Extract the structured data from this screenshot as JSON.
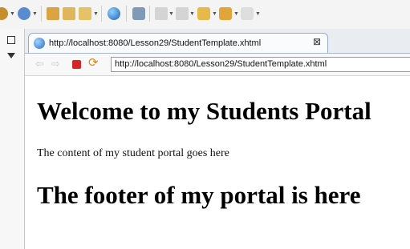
{
  "browser": {
    "tab": {
      "title": "http://localhost:8080/Lesson29/StudentTemplate.xhtml",
      "close_icon": "×"
    },
    "address": {
      "url": "http://localhost:8080/Lesson29/StudentTemplate.xhtml"
    },
    "icons": {
      "back": "⇦",
      "forward": "⇨",
      "refresh": "⟳",
      "close": "⊠"
    }
  },
  "page": {
    "heading": "Welcome to my Students Portal",
    "content": "The content of my student portal goes here",
    "footer": "The footer of my portal is here"
  },
  "colors": {
    "stop": "#d4262a",
    "tab_border": "#9aaac4",
    "accent": "#2d6fbf"
  }
}
